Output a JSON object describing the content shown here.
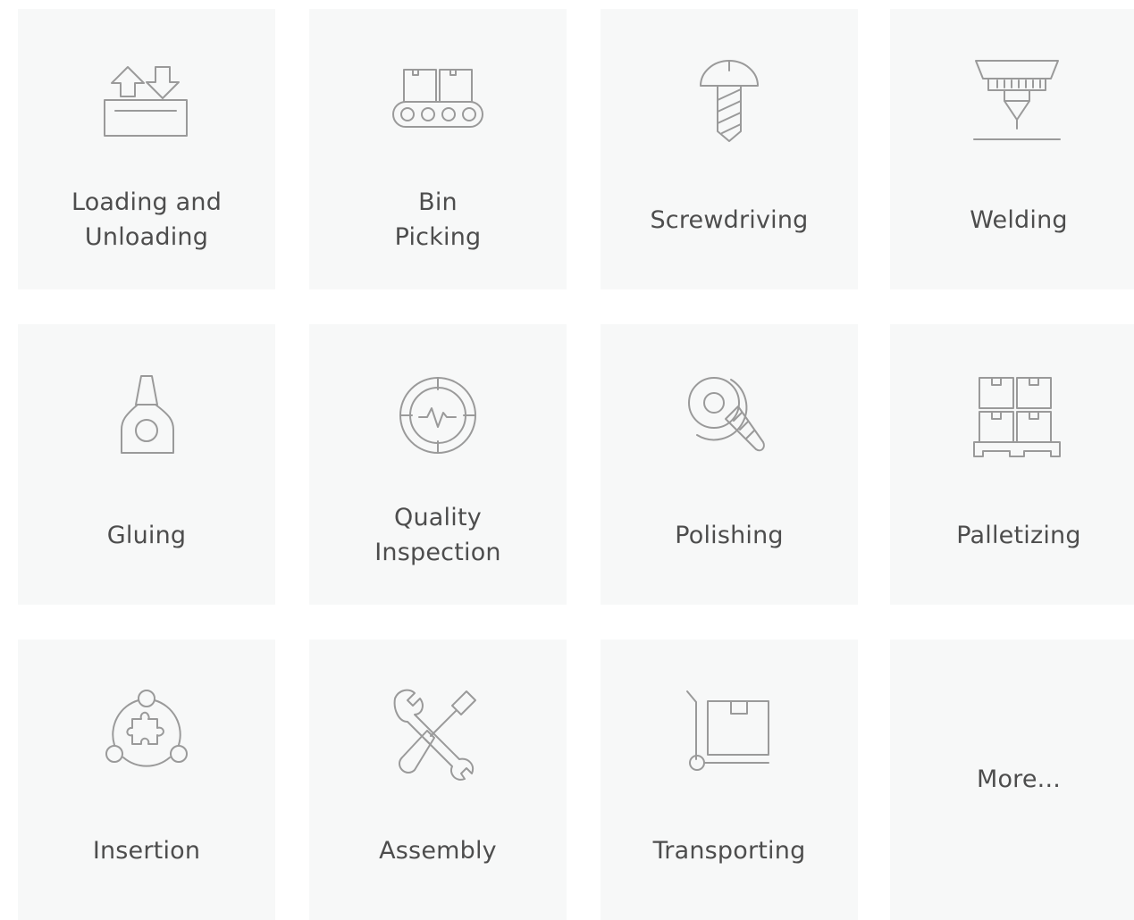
{
  "cards": [
    {
      "line1": "Loading and",
      "line2": "Unloading",
      "icon": "loading-unloading-icon"
    },
    {
      "line1": "Bin",
      "line2": "Picking",
      "icon": "conveyor-icon"
    },
    {
      "label": "Screwdriving",
      "icon": "screw-icon"
    },
    {
      "label": "Welding",
      "icon": "welding-torch-icon"
    },
    {
      "label": "Gluing",
      "icon": "glue-bottle-icon"
    },
    {
      "line1": "Quality",
      "line2": "Inspection",
      "icon": "inspection-gauge-icon"
    },
    {
      "label": "Polishing",
      "icon": "polishing-wheel-icon"
    },
    {
      "label": "Palletizing",
      "icon": "pallet-boxes-icon"
    },
    {
      "label": "Insertion",
      "icon": "puzzle-piece-icon"
    },
    {
      "label": "Assembly",
      "icon": "wrench-screwdriver-icon"
    },
    {
      "label": "Transporting",
      "icon": "hand-truck-icon"
    },
    {
      "label": "More..."
    }
  ],
  "colors": {
    "card_background": "#f7f8f8",
    "icon_stroke": "#9a9a9a",
    "label_text": "#4d4d4d"
  }
}
